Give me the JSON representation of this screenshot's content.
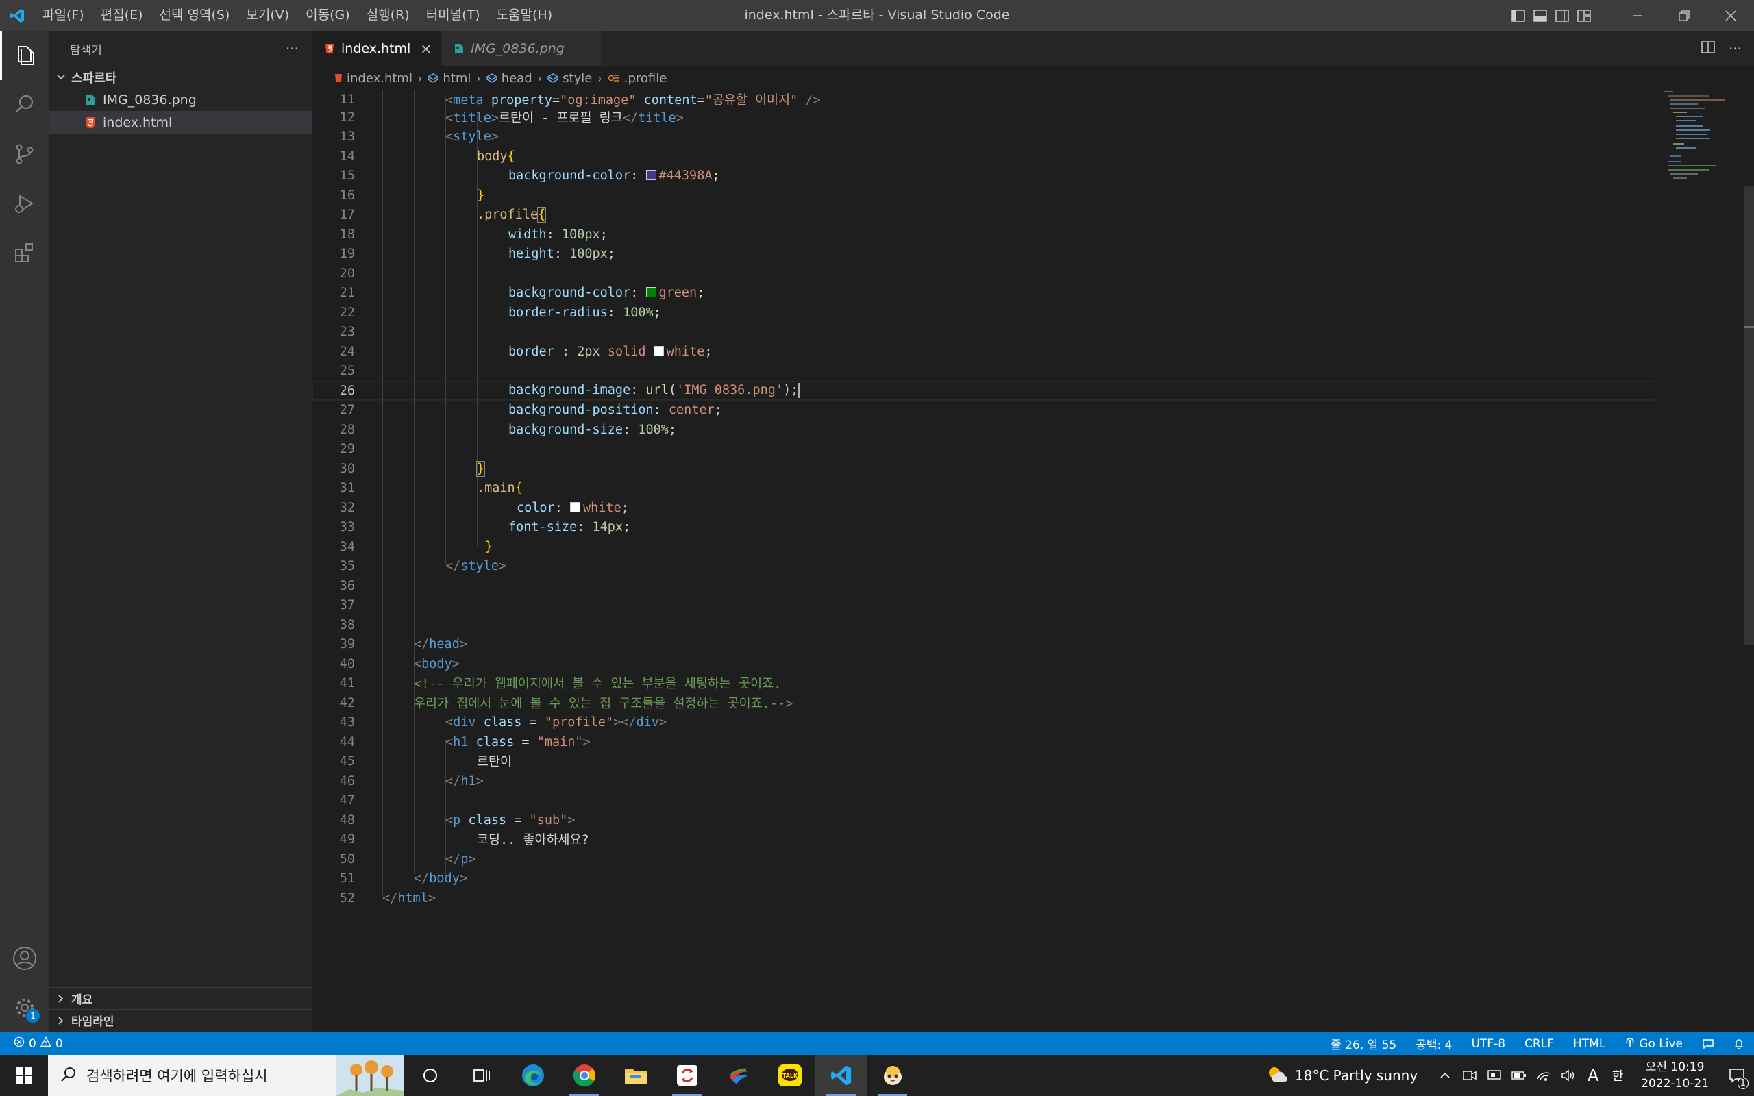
{
  "titlebar": {
    "title": "index.html - 스파르타 - Visual Studio Code",
    "menu": [
      "파일(F)",
      "편집(E)",
      "선택 영역(S)",
      "보기(V)",
      "이동(G)",
      "실행(R)",
      "터미널(T)",
      "도움말(H)"
    ]
  },
  "sidebar": {
    "header": "탐색기",
    "more": "···",
    "folder": "스파르타",
    "files": [
      {
        "name": "IMG_0836.png",
        "icon": "image-file-icon"
      },
      {
        "name": "index.html",
        "icon": "html-file-icon"
      }
    ],
    "outline": "개요",
    "timeline": "타임라인"
  },
  "tabs": [
    {
      "label": "index.html",
      "active": true,
      "close": "×"
    },
    {
      "label": "IMG_0836.png",
      "active": false
    }
  ],
  "breadcrumb": [
    "index.html",
    "html",
    "head",
    "style",
    ".profile"
  ],
  "editor": {
    "current_line": 26,
    "lines": [
      {
        "n": "11"
      },
      {
        "n": "12"
      },
      {
        "n": "13"
      },
      {
        "n": "14"
      },
      {
        "n": "15"
      },
      {
        "n": "16"
      },
      {
        "n": "17"
      },
      {
        "n": "18"
      },
      {
        "n": "19"
      },
      {
        "n": "20"
      },
      {
        "n": "21"
      },
      {
        "n": "22"
      },
      {
        "n": "23"
      },
      {
        "n": "24"
      },
      {
        "n": "25"
      },
      {
        "n": "26"
      },
      {
        "n": "27"
      },
      {
        "n": "28"
      },
      {
        "n": "29"
      },
      {
        "n": "30"
      },
      {
        "n": "31"
      },
      {
        "n": "32"
      },
      {
        "n": "33"
      },
      {
        "n": "34"
      },
      {
        "n": "35"
      },
      {
        "n": "36"
      },
      {
        "n": "37"
      },
      {
        "n": "38"
      },
      {
        "n": "39"
      },
      {
        "n": "40"
      },
      {
        "n": "41"
      },
      {
        "n": "42"
      },
      {
        "n": "43"
      },
      {
        "n": "44"
      },
      {
        "n": "45"
      },
      {
        "n": "46"
      },
      {
        "n": "47"
      },
      {
        "n": "48"
      },
      {
        "n": "49"
      },
      {
        "n": "50"
      },
      {
        "n": "51"
      },
      {
        "n": "52"
      }
    ],
    "text": {
      "l11_attr1": "property",
      "l11_v1": "\"og:image\"",
      "l11_attr2": "content",
      "l11_v2": "\"공유할 이미지\"",
      "l12_title": "르탄이 - 프로필 링크",
      "l14_sel": "body",
      "l15_prop": "background-color",
      "l15_val": "#44398A",
      "l17_sel": ".profile",
      "l18_prop": "width",
      "l18_val": "100px",
      "l19_prop": "height",
      "l19_val": "100px",
      "l21_prop": "background-color",
      "l21_val": "green",
      "l22_prop": "border-radius",
      "l22_val": "100%",
      "l24_prop": "border ",
      "l24_num": "2px",
      "l24_kw": "solid",
      "l24_val": "white",
      "l26_prop": "background-image",
      "l26_fn": "url",
      "l26_str": "'IMG_0836.png'",
      "l27_prop": "background-position",
      "l27_val": "center",
      "l28_prop": "background-size",
      "l28_val": "100%",
      "l31_sel": ".main",
      "l32_prop": "color",
      "l32_val": "white",
      "l33_prop": "font-size",
      "l33_val": "14px",
      "l41_cmt": "<!-- 우리가 웹페이지에서 볼 수 있는 부분을 세팅하는 곳이죠.",
      "l42_cmt": "우리가 집에서 눈에 볼 수 있는 집 구조들을 설정하는 곳이죠.-->",
      "l43_cls": "\"profile\"",
      "l44_cls": "\"main\"",
      "l45_txt": "르탄이",
      "l48_cls": "\"sub\"",
      "l49_txt": "코딩.. 좋아하세요?"
    },
    "colors": {
      "purple": "#44398A",
      "green": "#008000",
      "white": "#ffffff"
    }
  },
  "statusbar": {
    "errors": "0",
    "warnings": "0",
    "position": "줄 26, 열 55",
    "spaces": "공백: 4",
    "encoding": "UTF-8",
    "eol": "CRLF",
    "language": "HTML",
    "golive": "Go Live",
    "settings_badge": "1"
  },
  "taskbar": {
    "search_placeholder": "검색하려면 여기에 입력하십시",
    "weather": "18°C  Partly sunny",
    "time": "오전 10:19",
    "date": "2022-10-21",
    "ime": "A",
    "ime2": "한",
    "notif_count": "1"
  }
}
